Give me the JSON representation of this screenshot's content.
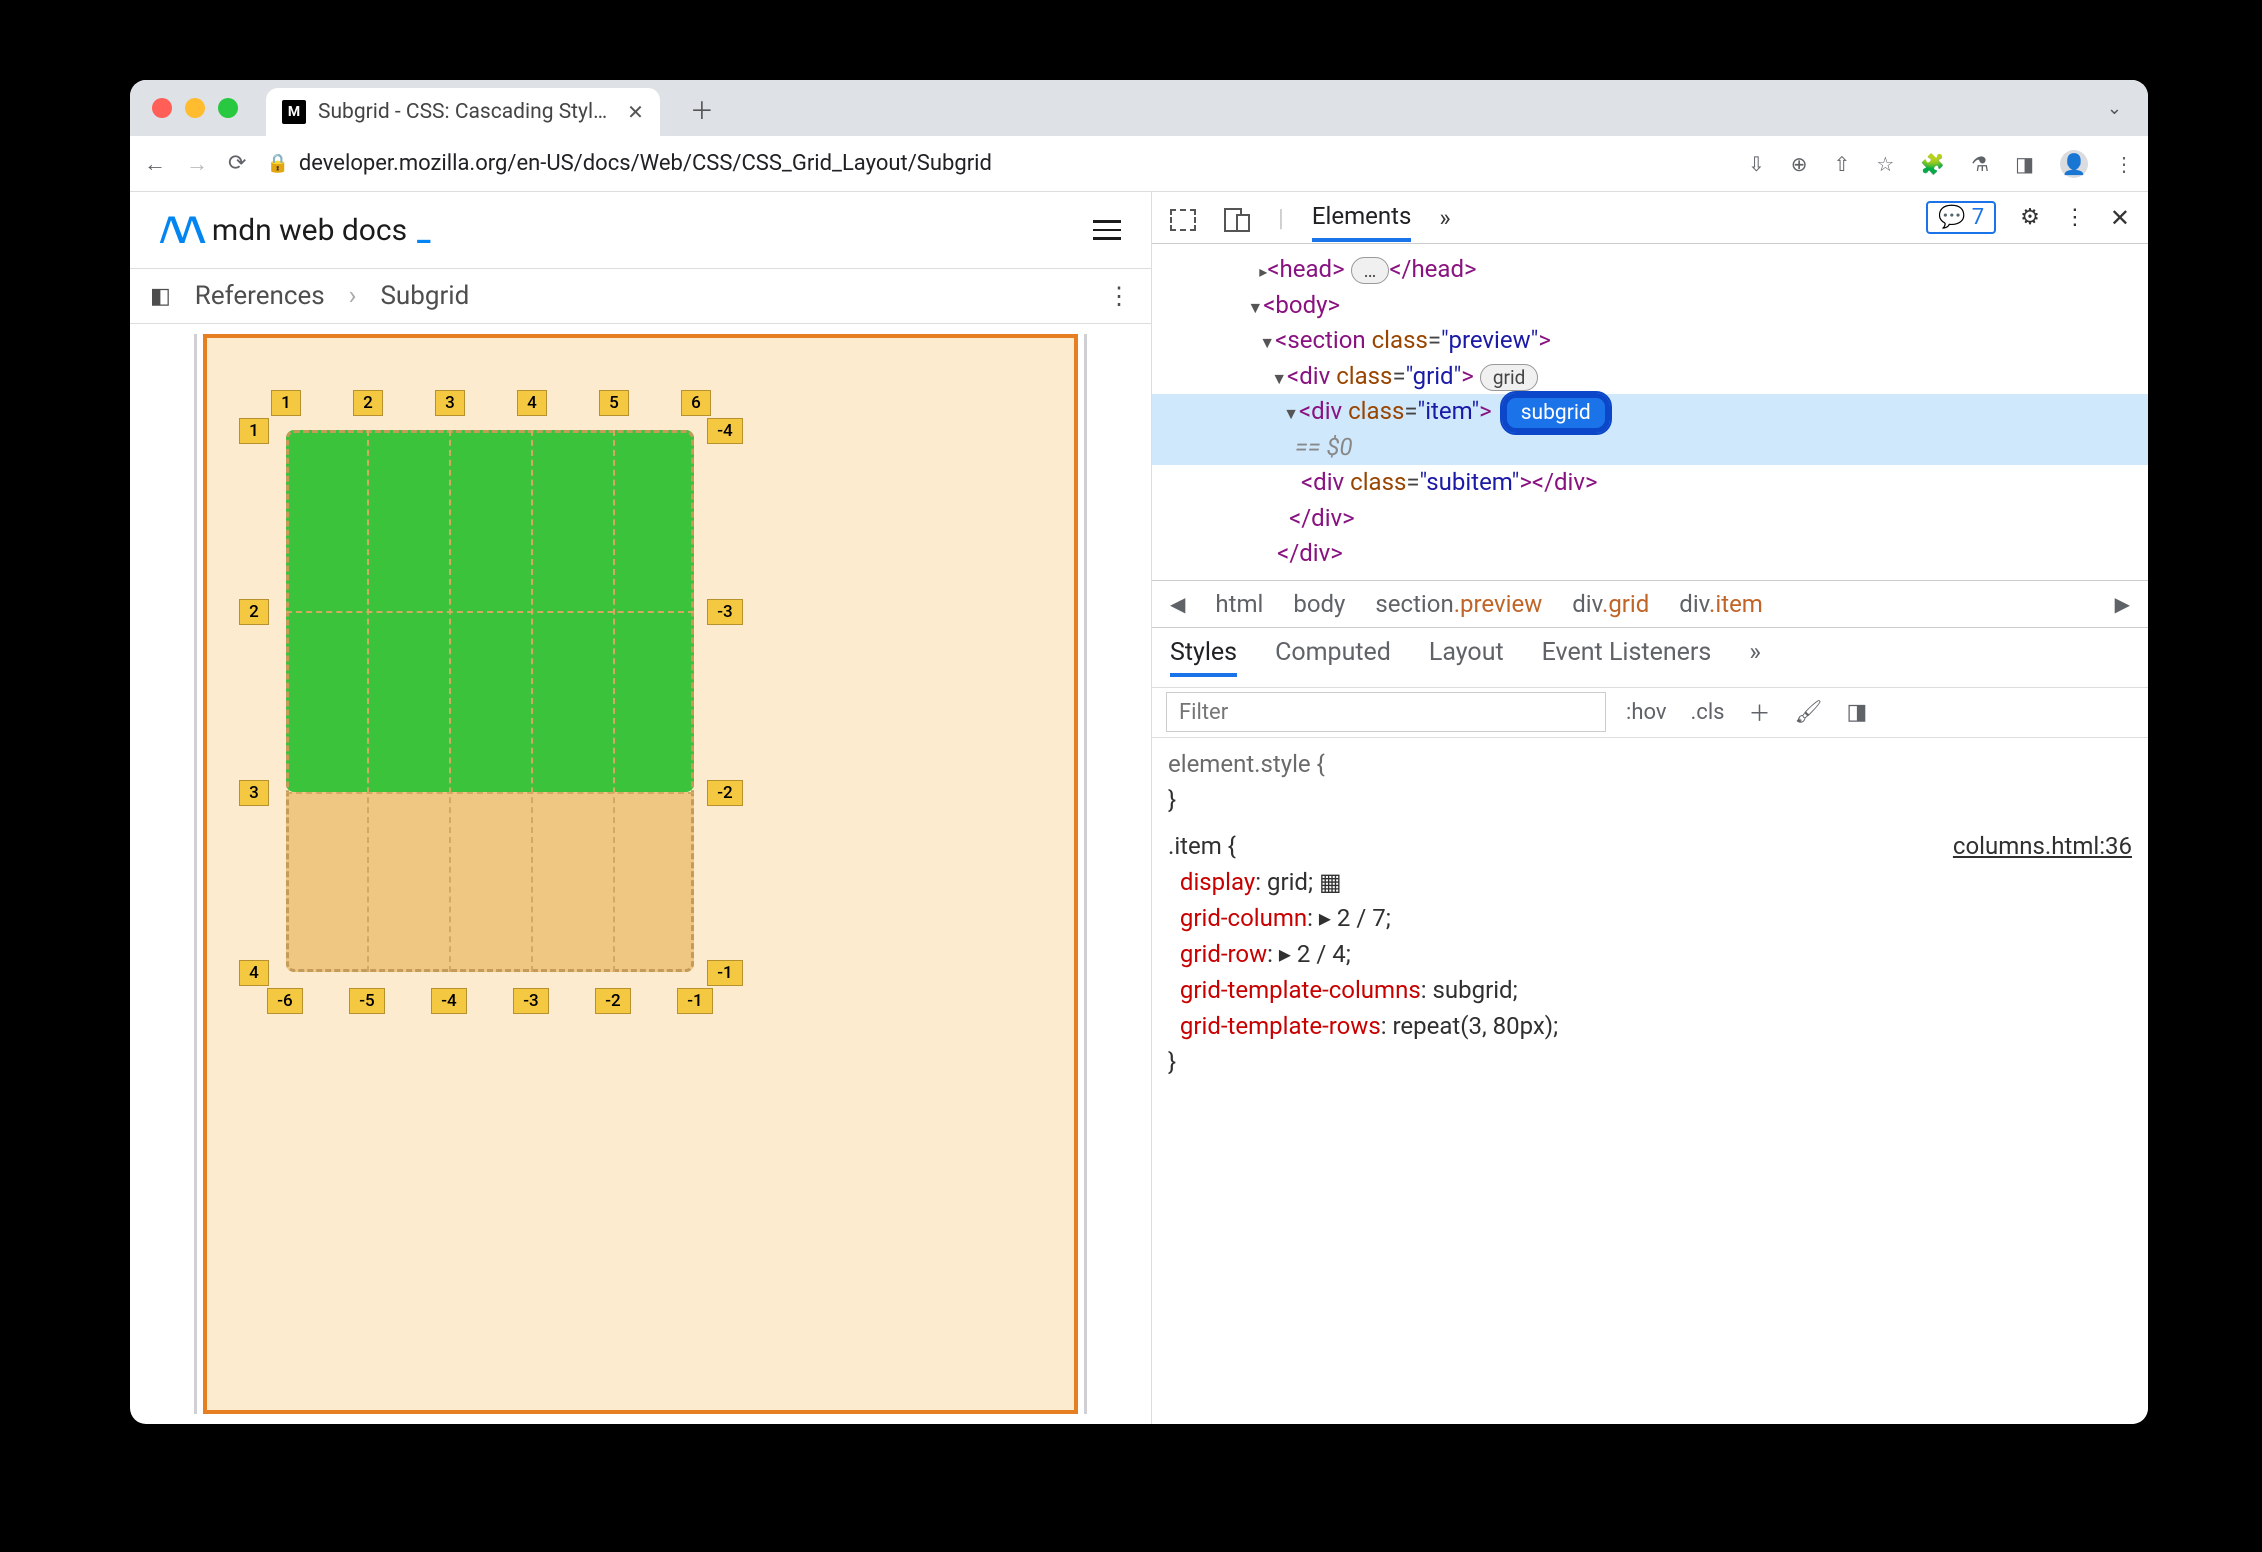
{
  "browser": {
    "tab_title": "Subgrid - CSS: Cascading Styl…",
    "url": "developer.mozilla.org/en-US/docs/Web/CSS/CSS_Grid_Layout/Subgrid"
  },
  "mdn": {
    "logo_text": "mdn web docs",
    "breadcrumb": {
      "ref": "References",
      "page": "Subgrid"
    }
  },
  "grid_overlay": {
    "top_labels": [
      "1",
      "2",
      "3",
      "4",
      "5",
      "6"
    ],
    "left_labels": [
      "1",
      "2",
      "3",
      "4"
    ],
    "right_labels": [
      "-4",
      "-3",
      "-2",
      "-1"
    ],
    "bottom_labels": [
      "-6",
      "-5",
      "-4",
      "-3",
      "-2",
      "-1"
    ]
  },
  "devtools": {
    "panel": "Elements",
    "issues": "7",
    "dom": {
      "head_open": "<head>",
      "head_ellipsis": "…",
      "head_close": "</head>",
      "body": "<body>",
      "section_open": "<section ",
      "section_attr": "class",
      "section_val": "\"preview\"",
      "section_close": ">",
      "grid_open": "<div ",
      "grid_attr": "class",
      "grid_val": "\"grid\"",
      "grid_close": ">",
      "grid_badge": "grid",
      "item_open": "<div ",
      "item_attr": "class",
      "item_val": "\"item\"",
      "item_close": ">",
      "subgrid_badge": "subgrid",
      "eq0": "== $0",
      "subitem": "<div class=\"subitem\"></div>",
      "div_close": "</div>"
    },
    "bc": [
      "html",
      "body",
      "section",
      ".preview",
      "div",
      ".grid",
      "div",
      ".item"
    ],
    "styles_tabs": [
      "Styles",
      "Computed",
      "Layout",
      "Event Listeners"
    ],
    "filter_placeholder": "Filter",
    "hov": ":hov",
    "cls": ".cls",
    "element_style": "element.style {",
    "brace_close": "}",
    "item_rule": ".item {",
    "source": "columns.html:36",
    "rules": [
      {
        "p": "display",
        "v": " grid;"
      },
      {
        "p": "grid-column",
        "v": " ▸ 2 / 7;"
      },
      {
        "p": "grid-row",
        "v": " ▸ 2 / 4;"
      },
      {
        "p": "grid-template-columns",
        "v": " subgrid;"
      },
      {
        "p": "grid-template-rows",
        "v": " repeat(3, 80px);"
      }
    ]
  }
}
